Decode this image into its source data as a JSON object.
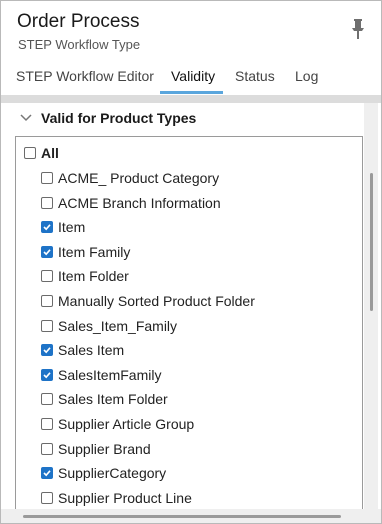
{
  "header": {
    "title": "Order Process",
    "subtitle": "STEP Workflow Type",
    "pin_icon": "pin-icon"
  },
  "tabs": [
    {
      "label": "STEP Workflow Editor",
      "active": false
    },
    {
      "label": "Validity",
      "active": true
    },
    {
      "label": "Status",
      "active": false
    },
    {
      "label": "Log",
      "active": false
    }
  ],
  "colors": {
    "tab_underline": "#5aa6dd",
    "checkbox_checked": "#1e73c7"
  },
  "section": {
    "title": "Valid for Product Types",
    "collapse_icon": "chevron-down-icon"
  },
  "list": {
    "all_label": "All",
    "all_checked": false,
    "items": [
      {
        "label": "ACME_ Product Category",
        "checked": false
      },
      {
        "label": "ACME Branch Information",
        "checked": false
      },
      {
        "label": "Item",
        "checked": true
      },
      {
        "label": "Item Family",
        "checked": true
      },
      {
        "label": "Item Folder",
        "checked": false
      },
      {
        "label": "Manually Sorted Product Folder",
        "checked": false
      },
      {
        "label": "Sales_Item_Family",
        "checked": false
      },
      {
        "label": "Sales Item",
        "checked": true
      },
      {
        "label": "SalesItemFamily",
        "checked": true
      },
      {
        "label": "Sales Item Folder",
        "checked": false
      },
      {
        "label": "Supplier Article Group",
        "checked": false
      },
      {
        "label": "Supplier Brand",
        "checked": false
      },
      {
        "label": "SupplierCategory",
        "checked": true
      },
      {
        "label": "Supplier Product Line",
        "checked": false
      }
    ]
  }
}
